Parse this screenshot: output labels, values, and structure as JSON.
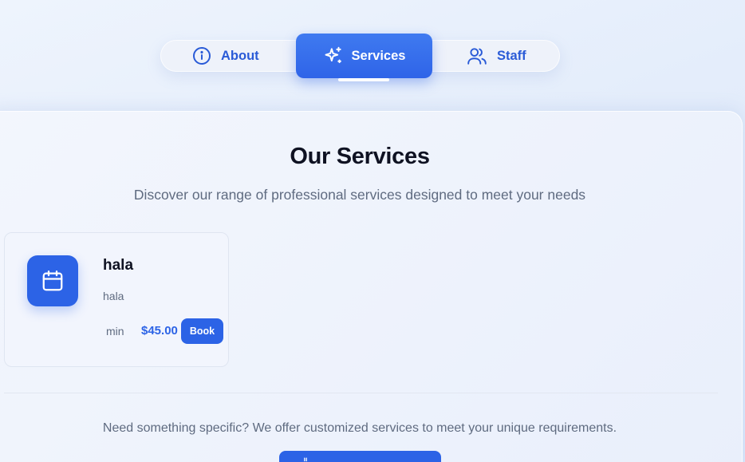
{
  "tabs": {
    "about": {
      "label": "About",
      "icon": "info-icon"
    },
    "services": {
      "label": "Services",
      "icon": "sparkles-icon",
      "active": true
    },
    "staff": {
      "label": "Staff",
      "icon": "users-icon"
    }
  },
  "section": {
    "title": "Our Services",
    "subtitle": "Discover our range of professional services designed to meet your needs"
  },
  "services": [
    {
      "name": "hala",
      "description": "hala",
      "duration": "min",
      "price": "$45.00",
      "book_label": "Book",
      "icon": "calendar-icon"
    }
  ],
  "cta": {
    "text": "Need something specific? We offer customized services to meet your unique requirements."
  },
  "colors": {
    "accent": "#2c63e6",
    "heading": "#0f1222",
    "muted": "#5f6b80"
  }
}
